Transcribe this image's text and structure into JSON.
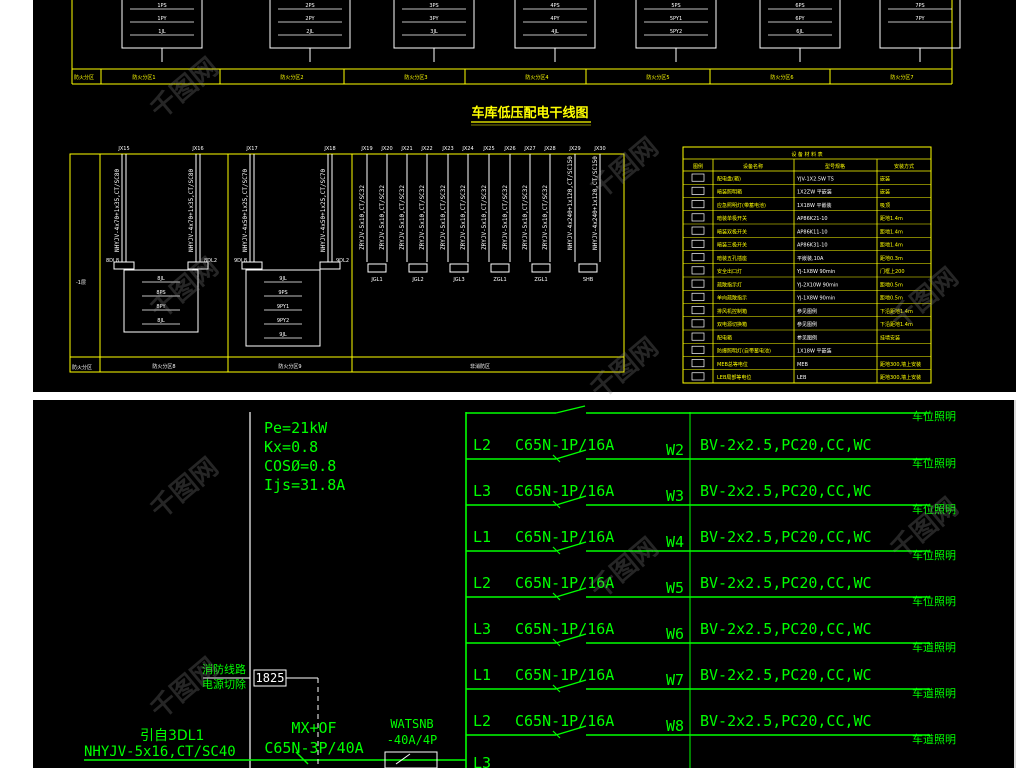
{
  "top": {
    "boxes": [
      {
        "a": "1PS",
        "b": "1PY",
        "c": "1JL",
        "label": "防火分区1"
      },
      {
        "a": "2PS",
        "b": "2PY",
        "c": "2JL",
        "label": "防火分区2"
      },
      {
        "a": "3PS",
        "b": "3PY",
        "c": "3JL",
        "label": "防火分区3"
      },
      {
        "a": "4PS",
        "b": "4PY",
        "c": "4JL",
        "label": "防火分区4"
      },
      {
        "a": "5PS",
        "b": "5PY1",
        "c": "5PY2",
        "label": "防火分区5"
      },
      {
        "a": "6PS",
        "b": "6PY",
        "c": "6JL",
        "label": "防火分区6"
      },
      {
        "a": "7PS",
        "b": "7PY",
        "c": "",
        "label": "防火分区7"
      }
    ],
    "row_label": "防火分区"
  },
  "riser": {
    "title": "车库低压配电干线图",
    "left_panel": {
      "jx": [
        "JX15",
        "JX16",
        "JX17",
        "JX18"
      ],
      "cables": [
        "NHYJV-4x70+1x35,CT/SC80",
        "NHYJV-4x70+1x35,CT/SC80",
        "NHYJV-4x50+1x25,CT/SC70",
        "NHYJV-4x50+1x25,CT/SC70"
      ],
      "dl": [
        "8DL8",
        "8DL2",
        "9DL8",
        "9DL2"
      ],
      "box1": [
        "8JL",
        "8PS",
        "8PY",
        "8JL"
      ],
      "box2": [
        "9JL",
        "9PS",
        "9PY1",
        "9PY2",
        "9JL"
      ],
      "floor": "-1层",
      "bottom_left": "防火分区",
      "bottom_labels": [
        "防火分区8",
        "防火分区9"
      ]
    },
    "right_panel": {
      "jx": [
        "JX19",
        "JX20",
        "JX21",
        "JX22",
        "JX23",
        "JX24",
        "JX25",
        "JX26",
        "JX27",
        "JX28",
        "JX29",
        "JX30"
      ],
      "cables": [
        "ZRYJV-5x10,CT/SC32",
        "ZRYJV-5x10,CT/SC32",
        "ZRYJV-5x10,CT/SC32",
        "ZRYJV-5x10,CT/SC32",
        "ZRYJV-5x10,CT/SC32",
        "ZRYJV-5x10,CT/SC32",
        "ZRYJV-5x10,CT/SC32",
        "ZRYJV-5x10,CT/SC32",
        "ZRYJV-5x10,CT/SC32",
        "ZRYJV-5x10,CT/SC32",
        "NHYJV-4x240+1x120,CT/SC150",
        "NHYJV-4x240+1x120,CT/SC150"
      ],
      "boxes": [
        "JGL1",
        "JGL2",
        "JGL3",
        "ZGL1",
        "ZGL1",
        "SHB"
      ],
      "bottom_label": "非消防区"
    }
  },
  "legend": {
    "title": "设 备 材 料 表",
    "headers": [
      "图例",
      "设备名称",
      "型号规格",
      "安装方式"
    ],
    "rows": [
      {
        "name": "配电盘(箱)",
        "model": "YJV-1X2.5W TS",
        "install": "嵌装"
      },
      {
        "name": "暗装照明箱",
        "model": "1X2ZW 平嵌装",
        "install": "嵌装"
      },
      {
        "name": "应急照明灯(带蓄电池)",
        "model": "1X18W 平嵌装",
        "install": "吸顶"
      },
      {
        "name": "暗装单极开关",
        "model": "AP86K21-10",
        "install": "距地1.4m"
      },
      {
        "name": "暗装双极开关",
        "model": "AP86K11-10",
        "install": "距地1.4m"
      },
      {
        "name": "暗装三极开关",
        "model": "AP86K31-10",
        "install": "距地1.4m"
      },
      {
        "name": "暗装五孔插座",
        "model": "平嵌装,10A",
        "install": "距地0.3m"
      },
      {
        "name": "安全出口灯",
        "model": "YJ-1X8W 90min",
        "install": "门框上200"
      },
      {
        "name": "疏散指示灯",
        "model": "YJ-2X10W 90min",
        "install": "距地0.5m"
      },
      {
        "name": "单向疏散指示",
        "model": "YJ-1X8W 90min",
        "install": "距地0.5m"
      },
      {
        "name": "排风机控制箱",
        "model": "参见图例",
        "install": "下沿距地1.4m"
      },
      {
        "name": "双电源切换箱",
        "model": "参见图例",
        "install": "下沿距地1.4m"
      },
      {
        "name": "配电箱",
        "model": "参见图例",
        "install": "挂墙安装"
      },
      {
        "name": "防爆照明灯(自带蓄电池)",
        "model": "1X18W 平嵌装",
        "install": ""
      },
      {
        "name": "MEB总等电位",
        "model": "MEB",
        "install": "距地300,墙上安装"
      },
      {
        "name": "LEB局部等电位",
        "model": "LEB",
        "install": "距地300,墙上安装"
      }
    ]
  },
  "schematic": {
    "params": [
      "Pe=21kW",
      "Kx=0.8",
      "COSØ=0.8",
      "Ijs=31.8A"
    ],
    "fire_note": [
      "消防线路",
      "电源切除"
    ],
    "fire_box": "1825",
    "incoming": [
      "引自3DL1",
      "NHYJV-5x16,CT/SC40"
    ],
    "main_breaker": [
      "MX+OF",
      "C65N-3P/40A"
    ],
    "switch": [
      "WATSNB",
      "-40A/4P"
    ],
    "top_partial": "车位照明",
    "circuits": [
      {
        "phase": "L2",
        "breaker": "C65N-1P/16A",
        "id": "W2",
        "cable": "BV-2x2.5,PC20,CC,WC",
        "use": "车位照明"
      },
      {
        "phase": "L3",
        "breaker": "C65N-1P/16A",
        "id": "W3",
        "cable": "BV-2x2.5,PC20,CC,WC",
        "use": "车位照明"
      },
      {
        "phase": "L1",
        "breaker": "C65N-1P/16A",
        "id": "W4",
        "cable": "BV-2x2.5,PC20,CC,WC",
        "use": "车位照明"
      },
      {
        "phase": "L2",
        "breaker": "C65N-1P/16A",
        "id": "W5",
        "cable": "BV-2x2.5,PC20,CC,WC",
        "use": "车位照明"
      },
      {
        "phase": "L3",
        "breaker": "C65N-1P/16A",
        "id": "W6",
        "cable": "BV-2x2.5,PC20,CC,WC",
        "use": "车道照明"
      },
      {
        "phase": "L1",
        "breaker": "C65N-1P/16A",
        "id": "W7",
        "cable": "BV-2x2.5,PC20,CC,WC",
        "use": "车道照明"
      },
      {
        "phase": "L2",
        "breaker": "C65N-1P/16A",
        "id": "W8",
        "cable": "BV-2x2.5,PC20,CC,WC",
        "use": "车道照明"
      }
    ],
    "last_phase": "L3"
  },
  "watermark": "千图网"
}
